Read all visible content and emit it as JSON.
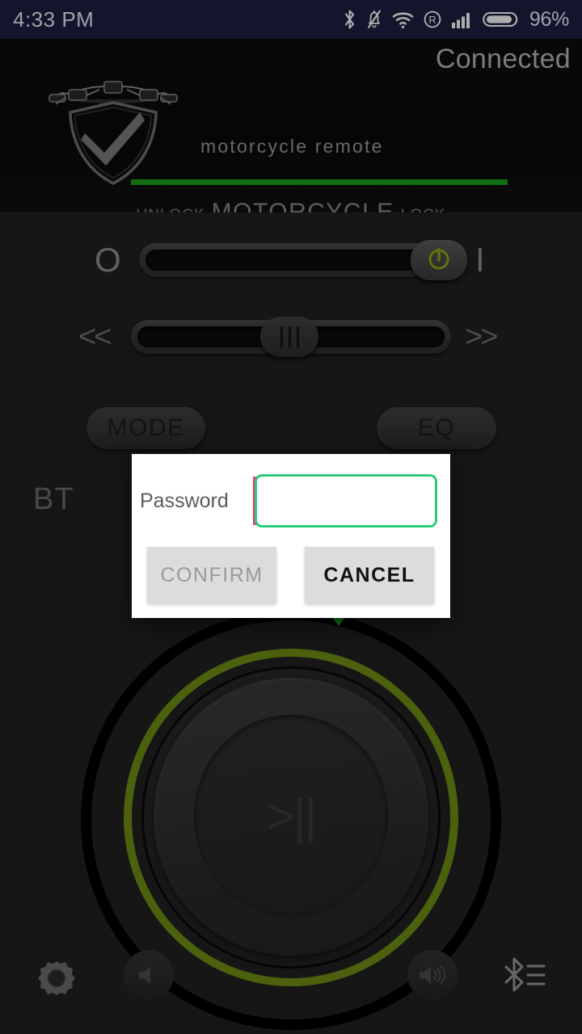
{
  "statusbar": {
    "time": "4:33 PM",
    "battery_percent": "96%",
    "icons": [
      "bluetooth-icon",
      "bell-muted-icon",
      "wifi-icon",
      "roaming-r-icon",
      "signal-bars-icon",
      "battery-icon"
    ]
  },
  "header": {
    "connection_status": "Connected",
    "device_name": "motorcycle  remote",
    "logo_icon": "motorcycle-shield-check-logo",
    "progress_color": "#18a21a",
    "unlock_label": "UNLOCK",
    "title_label": "MOTORCYCLE",
    "lock_label": "LOCK"
  },
  "controls": {
    "power_slider": {
      "left_label": "O",
      "right_label": "I",
      "knob_icon": "power-icon",
      "knob_color": "#94a614",
      "position_percent": 89
    },
    "track_slider": {
      "left_label": "<<",
      "right_label": ">>",
      "knob_icon": "grip-handle-icon",
      "position_percent": 50
    },
    "mode_button": "MODE",
    "eq_button": "EQ",
    "bt_label": "BT"
  },
  "dial": {
    "play_pause_glyph": ">||",
    "ring_color": "#6f8f14",
    "marker_color": "#1f9d1f"
  },
  "bottom_bar": {
    "settings_icon": "gear-icon",
    "volume_down_icon": "volume-low-icon",
    "volume_up_icon": "volume-high-icon",
    "bluetooth_list_icon": "bluetooth-list-icon"
  },
  "dialog": {
    "password_label": "Password",
    "password_value": "",
    "password_placeholder": "",
    "confirm_label": "CONFIRM",
    "cancel_label": "CANCEL",
    "input_border_color": "#2ec97a",
    "cursor_color": "#ea3a72"
  }
}
